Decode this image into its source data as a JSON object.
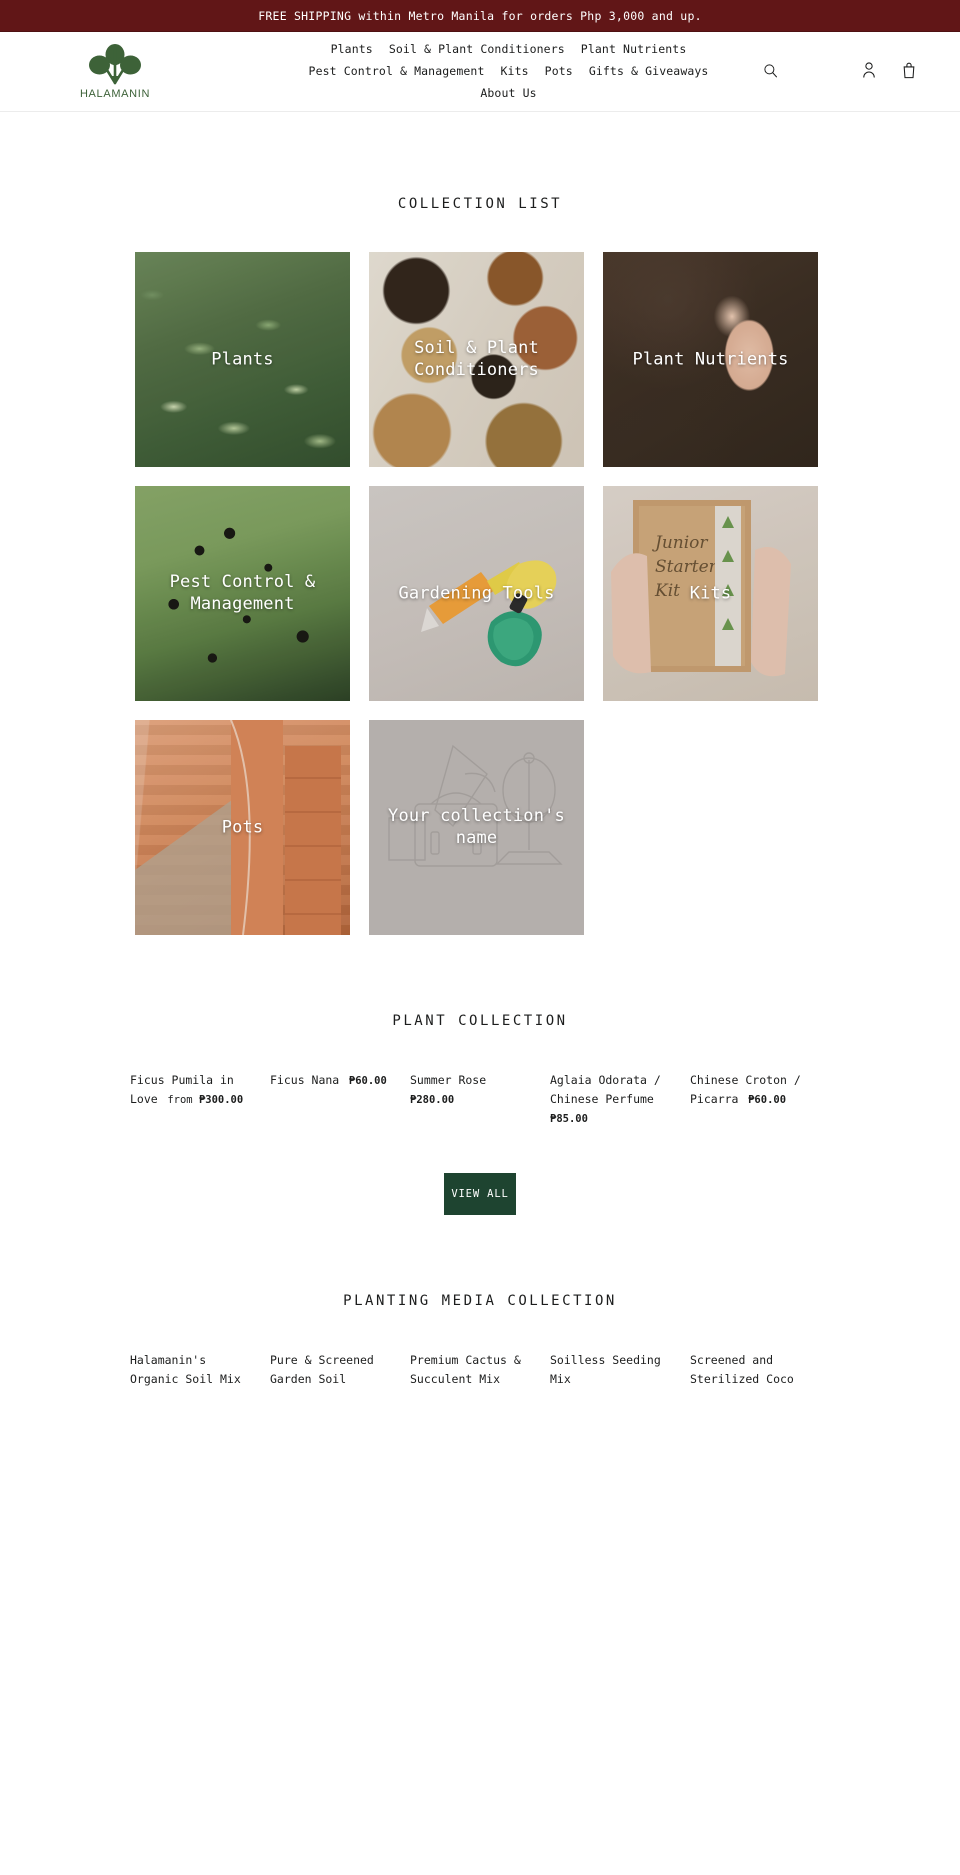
{
  "announcement": {
    "text": "FREE SHIPPING within Metro Manila for orders Php 3,000 and up."
  },
  "header": {
    "brand_name": "HALAMANIN",
    "nav_items": [
      {
        "label": "Plants"
      },
      {
        "label": "Soil & Plant Conditioners"
      },
      {
        "label": "Plant Nutrients"
      },
      {
        "label": "Pest Control & Management"
      },
      {
        "label": "Kits"
      },
      {
        "label": "Pots"
      },
      {
        "label": "Gifts & Giveaways"
      },
      {
        "label": "About Us"
      }
    ],
    "icons": {
      "search": "search-icon",
      "account": "account-icon",
      "cart": "cart-icon"
    }
  },
  "collection_list": {
    "title": "COLLECTION LIST",
    "cards": [
      {
        "label": "Plants",
        "art": "ph-plants"
      },
      {
        "label": "Soil & Plant Conditioners",
        "art": "ph-soil"
      },
      {
        "label": "Plant Nutrients",
        "art": "ph-nutrients"
      },
      {
        "label": "Pest Control & Management",
        "art": "ph-pest"
      },
      {
        "label": "Gardening Tools",
        "art": "ph-tools"
      },
      {
        "label": "Kits",
        "art": "ph-kits"
      },
      {
        "label": "Pots",
        "art": "ph-pots"
      },
      {
        "label": "Your collection's name",
        "art": "ph-placeholder"
      }
    ]
  },
  "plant_collection": {
    "title": "PLANT COLLECTION",
    "products": [
      {
        "name": "Ficus Pumila in Love",
        "price": "₱300.00",
        "price_prefix": "from "
      },
      {
        "name": "Ficus Nana",
        "price": "₱60.00",
        "price_prefix": ""
      },
      {
        "name": "Summer Rose",
        "price": "₱280.00",
        "price_prefix": ""
      },
      {
        "name": "Aglaia Odorata / Chinese Perfume",
        "price": "₱85.00",
        "price_prefix": ""
      },
      {
        "name": "Chinese Croton / Picarra",
        "price": "₱60.00",
        "price_prefix": ""
      }
    ],
    "view_all_label": "VIEW ALL"
  },
  "planting_media_collection": {
    "title": "PLANTING MEDIA COLLECTION",
    "products": [
      {
        "name": "Halamanin's Organic Soil Mix"
      },
      {
        "name": "Pure & Screened Garden Soil"
      },
      {
        "name": "Premium Cactus & Succulent Mix"
      },
      {
        "name": "Soilless Seeding Mix"
      },
      {
        "name": "Screened and Sterilized Coco"
      }
    ]
  },
  "colors": {
    "announcement_bg": "#611617",
    "brand_green": "#3d6238",
    "button_green": "#1e4430",
    "text": "#1c1d1d"
  }
}
